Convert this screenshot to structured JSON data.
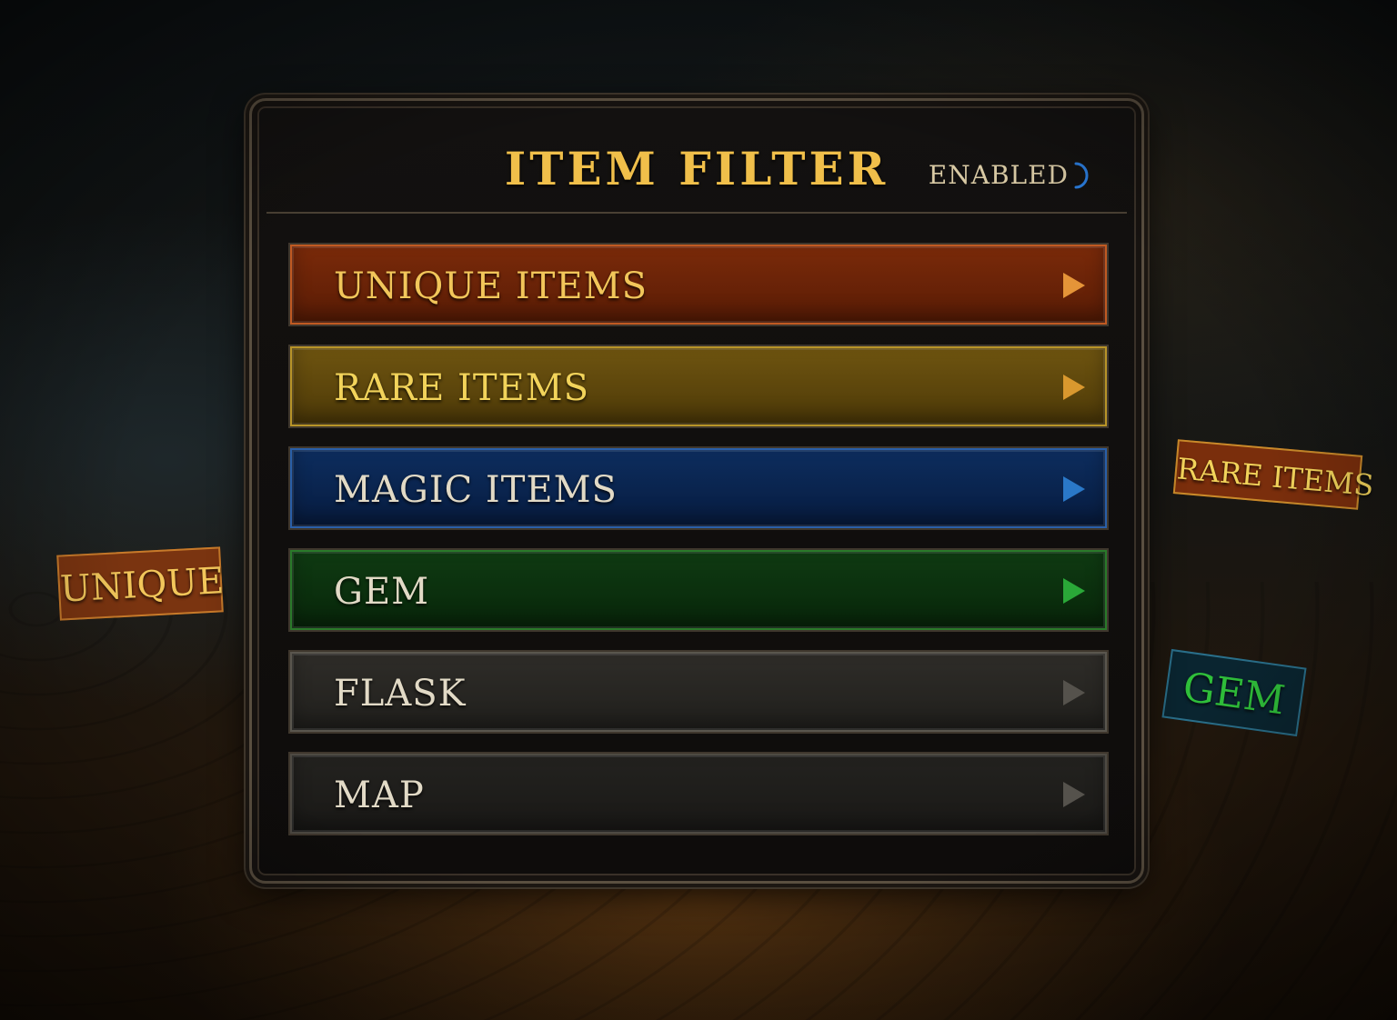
{
  "panel": {
    "title": "ITEM FILTER",
    "status": "ENABLED",
    "status_color": "#d8c9a4",
    "status_indicator_color": "#2a7ad8",
    "accent_color": "#f0bf4a"
  },
  "categories": [
    {
      "label": "UNIQUE ITEMS",
      "arrow_icon": "chevron-right-icon",
      "bg": "#7a2a0a",
      "bg_dark": "#5a1c05",
      "border": "#c05a22",
      "text_color": "#f2c65a",
      "arrow_color": "#e59438"
    },
    {
      "label": "RARE ITEMS",
      "arrow_icon": "chevron-right-icon",
      "bg": "#6e5410",
      "bg_dark": "#4e3a08",
      "border": "#b89428",
      "text_color": "#f2d35a",
      "arrow_color": "#d9982e"
    },
    {
      "label": "MAGIC ITEMS",
      "arrow_icon": "chevron-right-icon",
      "bg": "#0d2d5e",
      "bg_dark": "#071c40",
      "border": "#2a5fa8",
      "text_color": "#e2dac6",
      "arrow_color": "#2a78c8"
    },
    {
      "label": "GEM",
      "arrow_icon": "chevron-right-icon",
      "bg": "#0f3a12",
      "bg_dark": "#08270a",
      "border": "#2a7a2a",
      "text_color": "#e2dac6",
      "arrow_color": "#2aa838"
    },
    {
      "label": "FLASK",
      "arrow_icon": "chevron-right-icon",
      "bg": "#2e2c28",
      "bg_dark": "#21201d",
      "border": "#5a564e",
      "text_color": "#e2dac6",
      "arrow_color": "#55524c"
    },
    {
      "label": "MAP",
      "arrow_icon": "chevron-right-icon",
      "bg": "#23221f",
      "bg_dark": "#1a1917",
      "border": "#4e4a43",
      "text_color": "#e2dac6",
      "arrow_color": "#55524c"
    }
  ],
  "ground_labels": [
    {
      "name": "ground-label-unique",
      "text": "UNIQUE",
      "bg": "#7a3410",
      "border": "#c77a2a",
      "text_color": "#f2c65a"
    },
    {
      "name": "ground-label-rare",
      "text": "RARE ITEMS",
      "bg": "#7a2e0c",
      "border": "#c98a2a",
      "text_color": "#f2d35a"
    },
    {
      "name": "ground-label-gem",
      "text": "GEM",
      "bg": "#0a2530",
      "border": "#2a6f8a",
      "text_color": "#2fbf3a"
    }
  ]
}
